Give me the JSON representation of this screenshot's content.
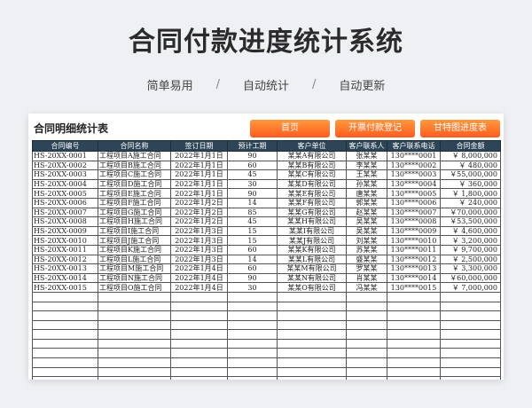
{
  "page": {
    "title": "合同付款进度统计系统",
    "subtitle": [
      "简单易用",
      "自动统计",
      "自动更新"
    ],
    "separator": "/"
  },
  "card": {
    "title": "合同明细统计表",
    "buttons": [
      "首页",
      "开票付款登记",
      "甘特图进度表"
    ]
  },
  "table": {
    "headers": [
      "合同编号",
      "合同名称",
      "签订日期",
      "预计工期",
      "客户单位",
      "客户联系人",
      "客户联系电话",
      "合同金额"
    ],
    "rows": [
      [
        "HS-20XX-0001",
        "工程项目A施工合同",
        "2022年1月1日",
        "90",
        "某某A有限公司",
        "张某某",
        "130****0001",
        "￥ 8,000,000"
      ],
      [
        "HS-20XX-0002",
        "工程项目B施工合同",
        "2022年1月1日",
        "60",
        "某某B有限公司",
        "李某某",
        "130****0002",
        "￥   480,000"
      ],
      [
        "HS-20XX-0003",
        "工程项目C施工合同",
        "2022年1月1日",
        "45",
        "某某C有限公司",
        "王某某",
        "130****0003",
        "￥55,000,000"
      ],
      [
        "HS-20XX-0004",
        "工程项目D施工合同",
        "2022年1月1日",
        "30",
        "某某D有限公司",
        "孙某某",
        "130****0004",
        "￥   360,000"
      ],
      [
        "HS-20XX-0005",
        "工程项目E施工合同",
        "2022年1月1日",
        "90",
        "某某E有限公司",
        "唐某某",
        "130****0005",
        "￥ 1,800,000"
      ],
      [
        "HS-20XX-0006",
        "工程项目F施工合同",
        "2022年1月2日",
        "14",
        "某某F有限公司",
        "郭某某",
        "130****0006",
        "￥   240,000"
      ],
      [
        "HS-20XX-0007",
        "工程项目G施工合同",
        "2022年1月2日",
        "85",
        "某某G有限公司",
        "赵某某",
        "130****0007",
        "￥70,000,000"
      ],
      [
        "HS-20XX-0008",
        "工程项目H施工合同",
        "2022年1月2日",
        "45",
        "某某H有限公司",
        "吴某某",
        "130****0008",
        "￥53,500,000"
      ],
      [
        "HS-20XX-0009",
        "工程项目I施工合同",
        "2022年1月3日",
        "15",
        "某某I有限公司",
        "吴某某",
        "130****0009",
        "￥ 4,600,000"
      ],
      [
        "HS-20XX-0010",
        "工程项目J施工合同",
        "2022年1月3日",
        "15",
        "某某J有限公司",
        "刘某某",
        "130****0010",
        "￥ 3,200,000"
      ],
      [
        "HS-20XX-0011",
        "工程项目K施工合同",
        "2022年1月3日",
        "60",
        "某某K有限公司",
        "苏某某",
        "130****0011",
        "￥ 9,700,000"
      ],
      [
        "HS-20XX-0012",
        "工程项目L施工合同",
        "2022年1月3日",
        "14",
        "某某L有限公司",
        "盛某某",
        "130****0012",
        "￥ 2,500,000"
      ],
      [
        "HS-20XX-0013",
        "工程项目M施工合同",
        "2022年1月4日",
        "60",
        "某某M有限公司",
        "罗某某",
        "130****0013",
        "￥ 3,300,000"
      ],
      [
        "HS-20XX-0014",
        "工程项目N施工合同",
        "2022年1月4日",
        "90",
        "某某N有限公司",
        "肖某某",
        "130****0014",
        "￥60,000,000"
      ],
      [
        "HS-20XX-0015",
        "工程项目O施工合同",
        "2022年1月4日",
        "30",
        "某某O有限公司",
        "冯某某",
        "130****0015",
        "￥ 7,000,000"
      ]
    ],
    "empty_rows": 10
  },
  "colors": {
    "header_bg": "#2d4556",
    "button_gradient_top": "#ff9a3c",
    "button_gradient_bottom": "#ff5a1f"
  }
}
